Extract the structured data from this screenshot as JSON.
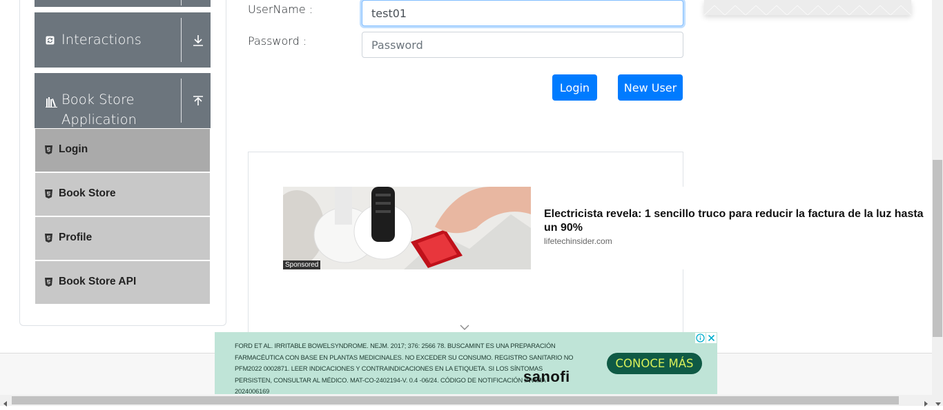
{
  "sidebar": {
    "groups": [
      {
        "label": "Interactions",
        "icon": "refresh-icon",
        "toggle_icon": "download-arrow-icon"
      },
      {
        "label_line1": "Book Store",
        "label_line2": "Application",
        "icon": "books-icon",
        "toggle_icon": "upload-arrow-icon"
      }
    ],
    "items": [
      {
        "label": "Login",
        "icon": "html5-icon",
        "active": true
      },
      {
        "label": "Book Store",
        "icon": "html5-icon"
      },
      {
        "label": "Profile",
        "icon": "html5-icon"
      },
      {
        "label": "Book Store API",
        "icon": "html5-icon"
      }
    ]
  },
  "form": {
    "username_label": "UserName :",
    "username_value": "test01",
    "password_label": "Password :",
    "password_placeholder": "Password",
    "login_button": "Login",
    "new_user_button": "New User"
  },
  "native_ad": {
    "title": "Electricista revela: 1 sencillo truco para reducir la factura de la luz hasta un 90%",
    "source": "lifetechinsider.com",
    "badge": "Sponsored"
  },
  "banner_ad": {
    "text": "FORD ET AL. IRRITABLE BOWELSYNDROME. NEJM. 2017; 376: 2566 78. BUSCAMINT ES UNA PREPARACIÓN FARMACÉUTICA CON BASE EN PLANTAS MEDICINALES. NO EXCEDER SU CONSUMO. REGISTRO SANITARIO NO PFM2022 0002871. LEER INDICACIONES Y CONTRAINDICACIONES EN LA ETIQUETA. SI LOS SÍNTOMAS PERSISTEN, CONSULTAR AL MÉDICO. MAT-CO-2402194-V. 0.4 -06/24. CÓDIGO DE NOTIFICACIÓN INVIMA 2024006169",
    "cta": "CONOCE MÁS",
    "brand": "sanofi"
  },
  "colors": {
    "primary": "#007bff",
    "sidebar_header": "#6c757d",
    "menu_item": "#c8c8c8",
    "banner_bg": "#bfe4d7"
  }
}
